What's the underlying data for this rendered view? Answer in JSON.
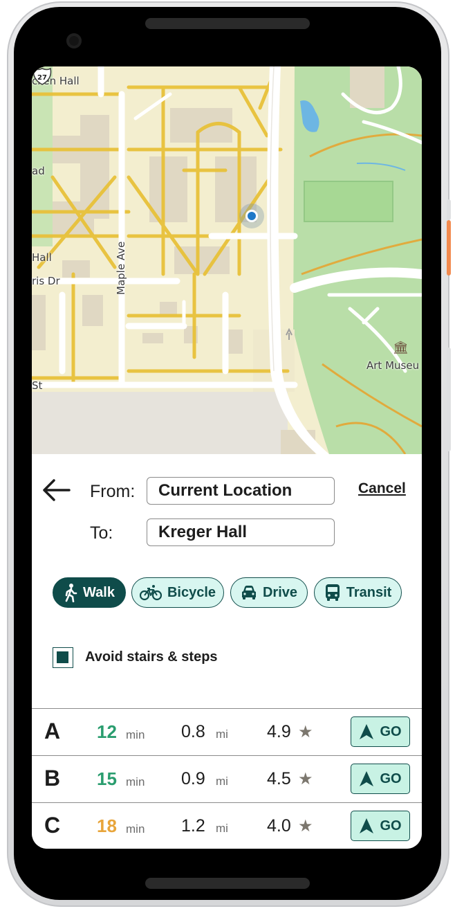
{
  "map": {
    "labels": {
      "hall_top": "cken Hall",
      "road_left": "ad",
      "hall_left": "Hall",
      "street_left": "ris Dr",
      "maple_ave": "Maple Ave",
      "street_bottom": "St",
      "highway": "27",
      "museum": "Art Museu"
    },
    "icons": {
      "location": "current-location-icon",
      "highway": "us-highway-shield-icon",
      "museum": "museum-icon"
    }
  },
  "directions": {
    "from_label": "From:",
    "from_value": "Current Location",
    "to_label": "To:",
    "to_value": "Kreger Hall",
    "cancel": "Cancel"
  },
  "modes": [
    {
      "label": "Walk",
      "icon": "walk-icon",
      "active": true
    },
    {
      "label": "Bicycle",
      "icon": "bicycle-icon",
      "active": false
    },
    {
      "label": "Drive",
      "icon": "car-icon",
      "active": false
    },
    {
      "label": "Transit",
      "icon": "bus-icon",
      "active": false
    }
  ],
  "options": {
    "avoid_stairs": "Avoid stairs & steps",
    "avoid_stairs_checked": true
  },
  "routes": [
    {
      "letter": "A",
      "minutes": "12",
      "min_unit": "min",
      "distance": "0.8",
      "dist_unit": "mi",
      "rating": "4.9",
      "star": "★",
      "go": "GO",
      "minutes_color": "#2a9d6f"
    },
    {
      "letter": "B",
      "minutes": "15",
      "min_unit": "min",
      "distance": "0.9",
      "dist_unit": "mi",
      "rating": "4.5",
      "star": "★",
      "go": "GO",
      "minutes_color": "#2a9d6f"
    },
    {
      "letter": "C",
      "minutes": "18",
      "min_unit": "min",
      "distance": "1.2",
      "dist_unit": "mi",
      "rating": "4.0",
      "star": "★",
      "go": "GO",
      "minutes_color": "#e8a53b"
    }
  ],
  "colors": {
    "accent": "#0f4c4a",
    "mode_bg": "#d8f6f0",
    "go_bg": "#c8f2e4",
    "park": "#b9dea8",
    "campus": "#f3eecf",
    "path": "#e8c13a"
  }
}
